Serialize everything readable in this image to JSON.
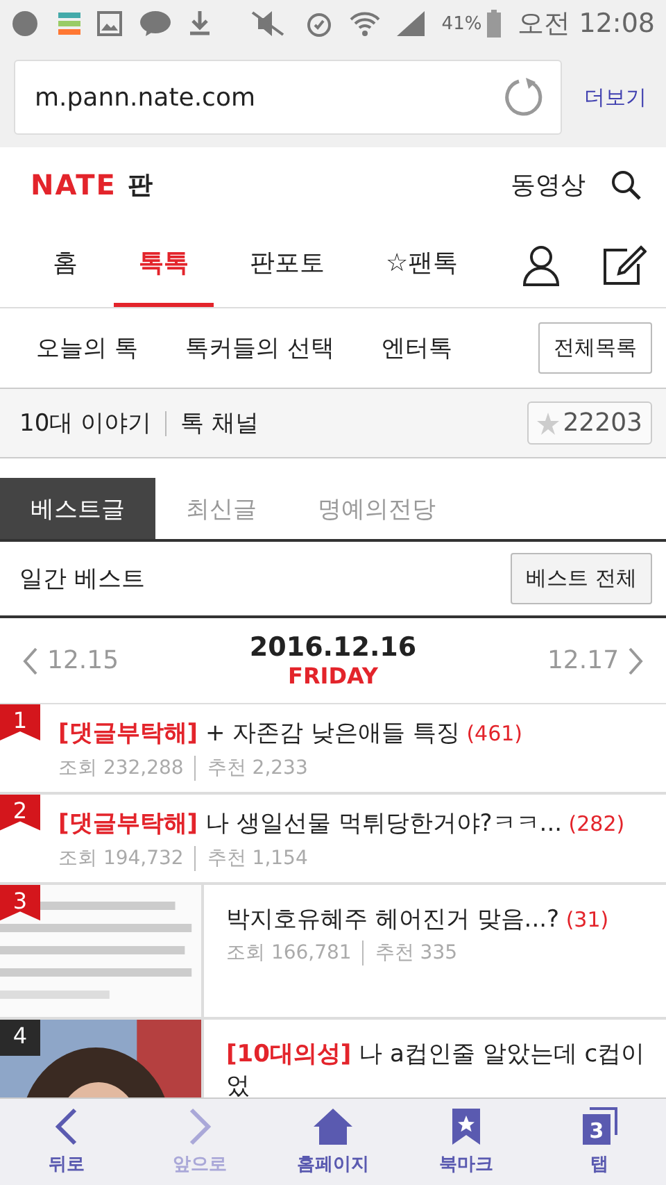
{
  "status_bar": {
    "battery": "41%",
    "time": "오전 12:08"
  },
  "browser": {
    "url": "m.pann.nate.com",
    "more": "더보기"
  },
  "header": {
    "logo": "NATE",
    "logo_sub": "판",
    "video": "동영상"
  },
  "tabs": [
    {
      "label": "홈",
      "selected": false
    },
    {
      "label": "톡톡",
      "selected": true
    },
    {
      "label": "판포토",
      "selected": false
    },
    {
      "label": "팬톡",
      "selected": false,
      "icon": "☆"
    }
  ],
  "subnav": {
    "items": [
      "오늘의 톡",
      "톡커들의 선택",
      "엔터톡"
    ],
    "all": "전체목록"
  },
  "channel": {
    "title": "10대 이야기",
    "sub": "톡 채널",
    "favorites": "22203"
  },
  "best_tabs": [
    {
      "label": "베스트글",
      "selected": true
    },
    {
      "label": "최신글",
      "selected": false
    },
    {
      "label": "명예의전당",
      "selected": false
    }
  ],
  "daily": {
    "title": "일간 베스트",
    "all": "베스트 전체"
  },
  "date_nav": {
    "prev": "12.15",
    "date": "2016.12.16",
    "weekday": "FRIDAY",
    "next": "12.17"
  },
  "posts": [
    {
      "rank": "1",
      "top": true,
      "tag": "[댓글부탁해]",
      "title": "+ 자존감 낮은애들 특징",
      "count": "(461)",
      "views": "조회 232,288",
      "likes": "추천 2,233"
    },
    {
      "rank": "2",
      "top": true,
      "tag": "[댓글부탁해]",
      "title": "나 생일선물 먹튀당한거야?ㅋㅋ...",
      "count": "(282)",
      "views": "조회 194,732",
      "likes": "추천 1,154"
    },
    {
      "rank": "3",
      "top": true,
      "kind": "picture",
      "title": "박지호유혜주 헤어진거 맞음...?",
      "count": "(31)",
      "views": "조회 166,781",
      "likes": "추천 335"
    },
    {
      "rank": "4",
      "top": false,
      "kind": "picture",
      "tag": "[10대의성]",
      "title": "나 a컵인줄 알았는데 c컵이었"
    }
  ],
  "bottom_bar": [
    {
      "kind": "back",
      "label": "뒤로",
      "disabled": false
    },
    {
      "kind": "forward",
      "label": "앞으로",
      "disabled": true
    },
    {
      "kind": "home",
      "label": "홈페이지",
      "disabled": false
    },
    {
      "kind": "bookmark",
      "label": "북마크",
      "disabled": false
    },
    {
      "kind": "tabs",
      "label": "탭",
      "count": "3",
      "disabled": false
    }
  ]
}
